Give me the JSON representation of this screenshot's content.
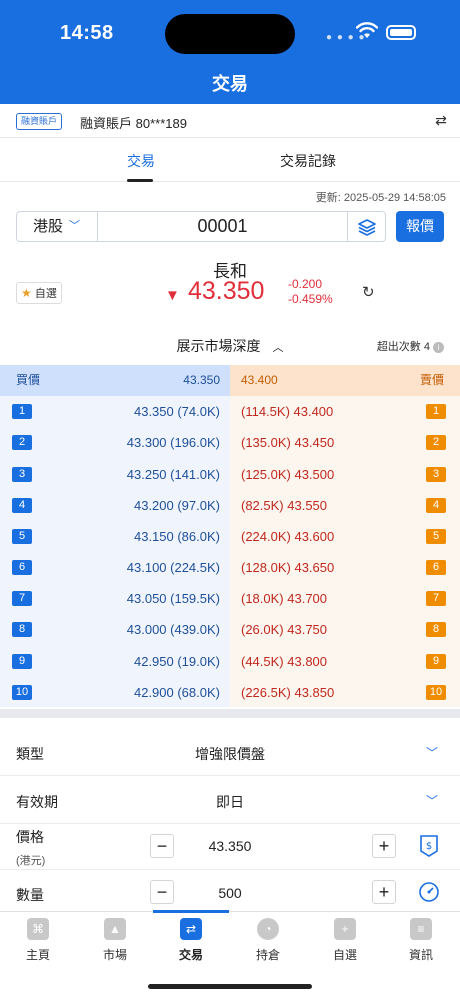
{
  "status_bar": {
    "time": "14:58"
  },
  "header": {
    "title": "交易"
  },
  "account": {
    "badge": "融資賬戶",
    "label": "融資賬戶 80***189"
  },
  "tabs": [
    {
      "label": "交易",
      "active": true
    },
    {
      "label": "交易記錄",
      "active": false
    }
  ],
  "updated": "更新: 2025-05-29 14:58:05",
  "search": {
    "market": "港股",
    "code": "00001",
    "quote_button": "報價"
  },
  "stock": {
    "name": "長和",
    "favorite_label": "自選",
    "price": "43.350",
    "change": "-0.200",
    "change_pct": "-0.459%",
    "direction": "down",
    "color": "#e02f3a"
  },
  "depth": {
    "toggle_label": "展示市場深度",
    "exceed_label": "超出次數 4",
    "bid_header": "買價",
    "bid_header_price": "43.350",
    "ask_header": "賣價",
    "ask_header_price": "43.400",
    "bids": [
      {
        "level": "1",
        "text": "43.350 (74.0K)"
      },
      {
        "level": "2",
        "text": "43.300 (196.0K)"
      },
      {
        "level": "3",
        "text": "43.250 (141.0K)"
      },
      {
        "level": "4",
        "text": "43.200 (97.0K)"
      },
      {
        "level": "5",
        "text": "43.150 (86.0K)"
      },
      {
        "level": "6",
        "text": "43.100 (224.5K)"
      },
      {
        "level": "7",
        "text": "43.050 (159.5K)"
      },
      {
        "level": "8",
        "text": "43.000 (439.0K)"
      },
      {
        "level": "9",
        "text": "42.950 (19.0K)"
      },
      {
        "level": "10",
        "text": "42.900 (68.0K)"
      }
    ],
    "asks": [
      {
        "level": "1",
        "text": "(114.5K) 43.400"
      },
      {
        "level": "2",
        "text": "(135.0K) 43.450"
      },
      {
        "level": "3",
        "text": "(125.0K) 43.500"
      },
      {
        "level": "4",
        "text": "(82.5K) 43.550"
      },
      {
        "level": "5",
        "text": "(224.0K) 43.600"
      },
      {
        "level": "6",
        "text": "(128.0K) 43.650"
      },
      {
        "level": "7",
        "text": "(18.0K) 43.700"
      },
      {
        "level": "8",
        "text": "(26.0K) 43.750"
      },
      {
        "level": "9",
        "text": "(44.5K) 43.800"
      },
      {
        "level": "10",
        "text": "(226.5K) 43.850"
      }
    ]
  },
  "order_form": {
    "type_label": "類型",
    "type_value": "增強限價盤",
    "validity_label": "有效期",
    "validity_value": "即日",
    "price_label": "價格",
    "price_unit": "(港元)",
    "price_value": "43.350",
    "qty_label": "數量",
    "qty_value": "500",
    "minus": "−",
    "plus": "+"
  },
  "tabbar": [
    {
      "label": "主頁",
      "icon": "home-icon"
    },
    {
      "label": "市場",
      "icon": "market-chart-icon"
    },
    {
      "label": "交易",
      "icon": "trade-swap-icon",
      "active": true
    },
    {
      "label": "持倉",
      "icon": "pie-chart-icon"
    },
    {
      "label": "自選",
      "icon": "plus-square-icon"
    },
    {
      "label": "資訊",
      "icon": "document-icon"
    }
  ]
}
